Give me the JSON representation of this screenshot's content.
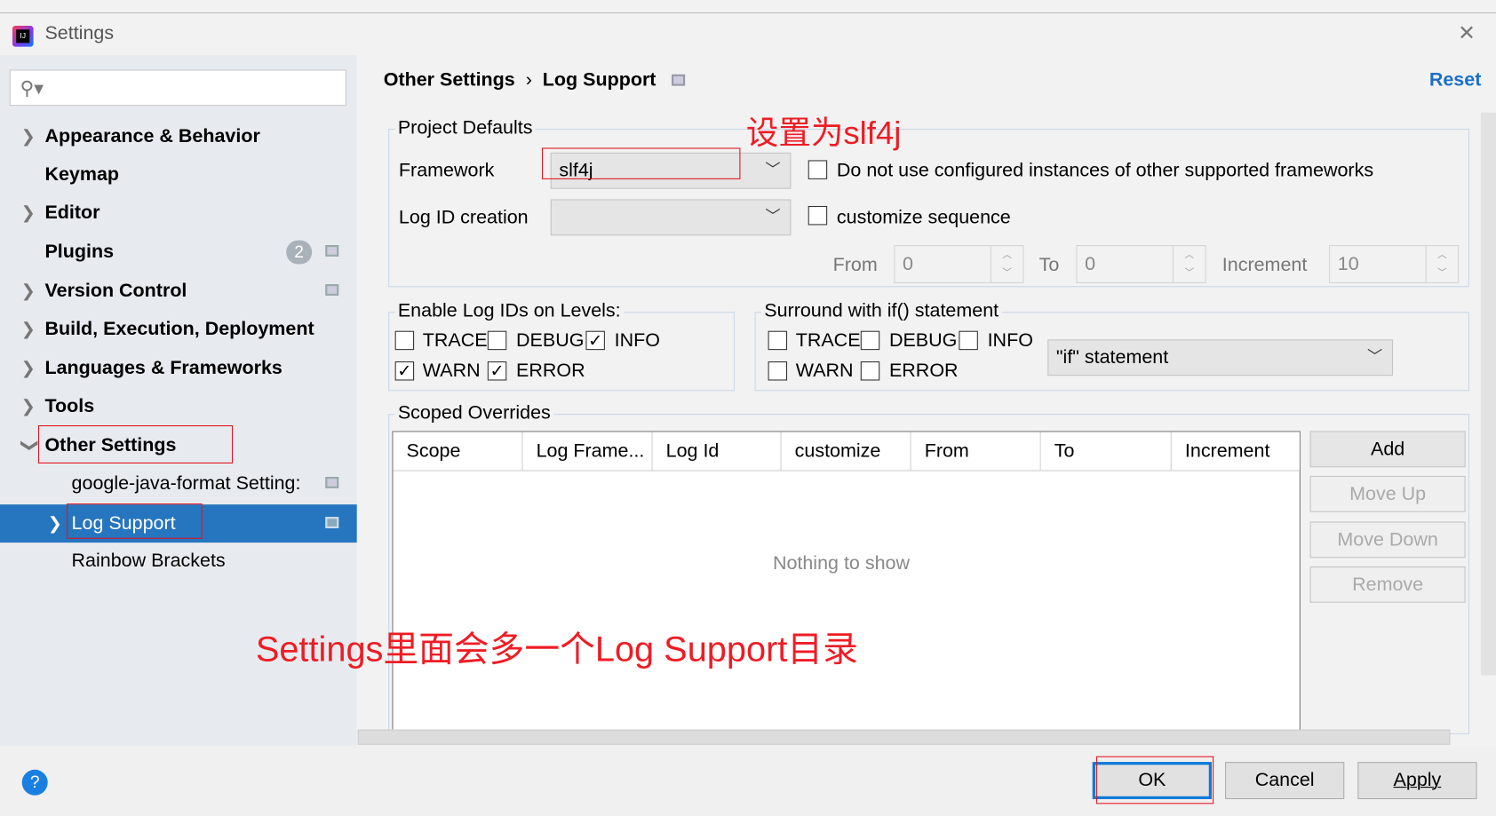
{
  "window": {
    "title": "Settings",
    "close_icon": "close-icon"
  },
  "sidebar": {
    "search_placeholder": "",
    "items": [
      {
        "label": "Appearance & Behavior",
        "expandable": true
      },
      {
        "label": "Keymap"
      },
      {
        "label": "Editor",
        "expandable": true
      },
      {
        "label": "Plugins",
        "badge": "2"
      },
      {
        "label": "Version Control",
        "expandable": true
      },
      {
        "label": "Build, Execution, Deployment",
        "expandable": true
      },
      {
        "label": "Languages & Frameworks",
        "expandable": true
      },
      {
        "label": "Tools",
        "expandable": true
      },
      {
        "label": "Other Settings",
        "expanded": true
      },
      {
        "label": "google-java-format Setting:"
      },
      {
        "label": "Log Support",
        "selected": true
      },
      {
        "label": "Rainbow Brackets"
      }
    ]
  },
  "header": {
    "breadcrumb": [
      "Other Settings",
      "Log Support"
    ],
    "separator": "›",
    "reset": "Reset"
  },
  "project_defaults": {
    "title": "Project Defaults",
    "framework_label": "Framework",
    "framework_value": "slf4j",
    "no_configured_label": "Do not use configured instances of other supported frameworks",
    "no_configured_checked": false,
    "log_id_label": "Log ID creation",
    "log_id_value": "",
    "customize_label": "customize sequence",
    "customize_checked": false,
    "from_label": "From",
    "from_value": "0",
    "to_label": "To",
    "to_value": "0",
    "increment_label": "Increment",
    "increment_value": "10"
  },
  "levels": {
    "title": "Enable Log IDs on Levels:",
    "items": [
      {
        "label": "TRACE",
        "checked": false
      },
      {
        "label": "DEBUG",
        "checked": false
      },
      {
        "label": "INFO",
        "checked": true
      },
      {
        "label": "WARN",
        "checked": true
      },
      {
        "label": "ERROR",
        "checked": true
      }
    ]
  },
  "surround": {
    "title": "Surround with if() statement",
    "items": [
      {
        "label": "TRACE",
        "checked": false
      },
      {
        "label": "DEBUG",
        "checked": false
      },
      {
        "label": "INFO",
        "checked": false
      },
      {
        "label": "WARN",
        "checked": false
      },
      {
        "label": "ERROR",
        "checked": false
      }
    ],
    "statement_value": "\"if\" statement"
  },
  "scoped": {
    "title": "Scoped Overrides",
    "columns": [
      "Scope",
      "Log Frame...",
      "Log Id",
      "customize",
      "From",
      "To",
      "Increment"
    ],
    "empty_text": "Nothing to show",
    "buttons": {
      "add": "Add",
      "move_up": "Move Up",
      "move_down": "Move Down",
      "remove": "Remove"
    }
  },
  "footer": {
    "help": "?",
    "ok": "OK",
    "cancel": "Cancel",
    "apply": "Apply"
  },
  "annotations": {
    "framework_note": "设置为slf4j",
    "menu_note": "Settings里面会多一个Log Support目录"
  },
  "colors": {
    "accent": "#2675bf",
    "link": "#1a6fc9",
    "annotation": "#ee1c25"
  }
}
